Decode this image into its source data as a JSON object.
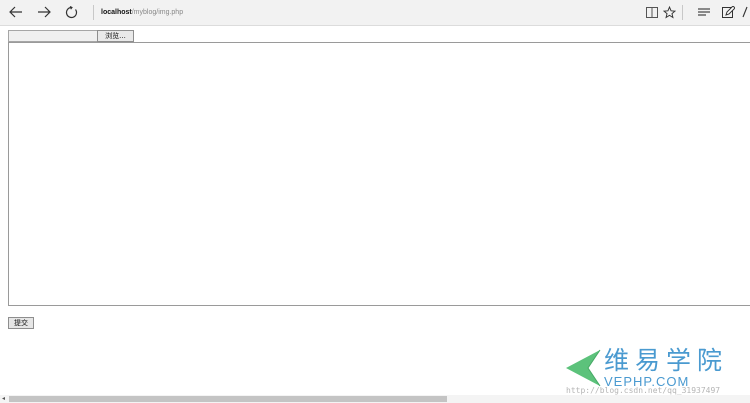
{
  "browser": {
    "url_host": "localhost",
    "url_path": "/myblog/img.php",
    "icons": {
      "back": "arrow-left-icon",
      "forward": "arrow-right-icon",
      "refresh": "refresh-icon",
      "reading_view": "book-icon",
      "favorite": "star-icon",
      "hub": "hub-icon",
      "web_note": "pen-icon"
    }
  },
  "form": {
    "file_path_value": "",
    "browse_label": "浏览...",
    "textarea_value": "",
    "submit_label": "提交"
  },
  "watermark": {
    "chinese": "维易学院",
    "english": "VEPHP.COM",
    "url": "http://blog.csdn.net/qq_31937497"
  },
  "colors": {
    "watermark_blue": "#4a9ad0",
    "watermark_green": "#5cc27b"
  }
}
